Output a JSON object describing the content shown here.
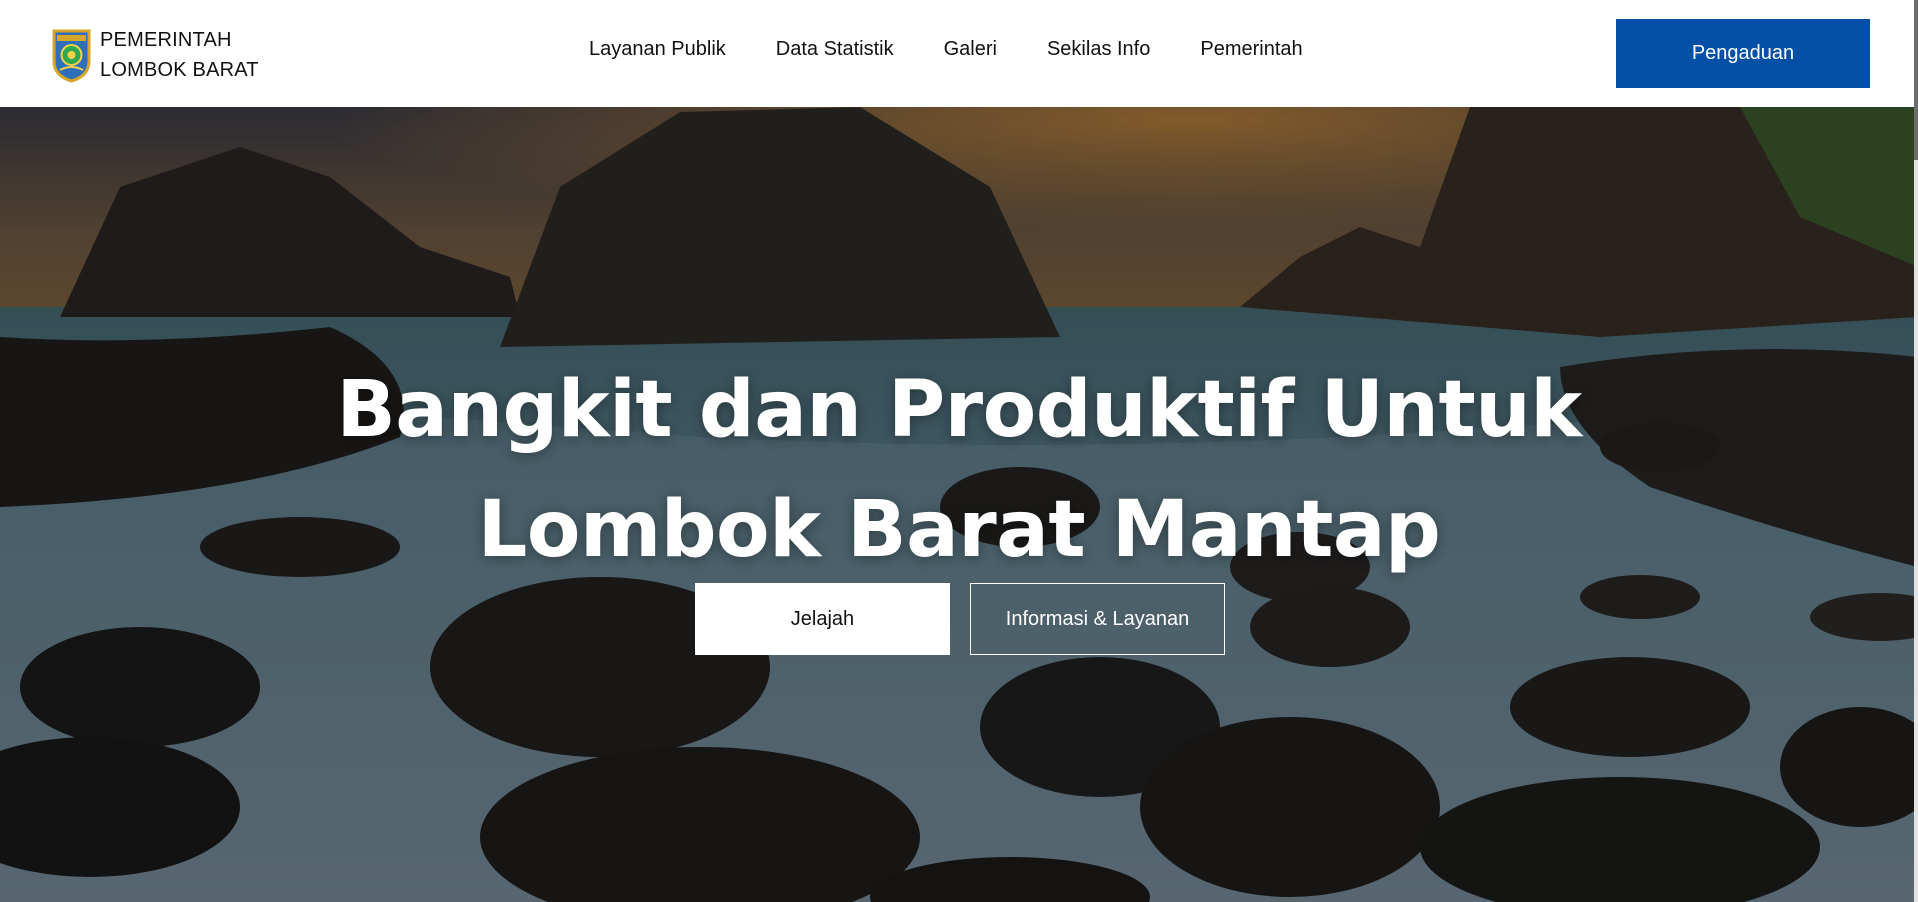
{
  "brand": {
    "line1": "PEMERINTAH",
    "line2": "LOMBOK BARAT",
    "logo_icon": "lombok-barat-emblem-icon"
  },
  "nav": {
    "items": [
      {
        "label": "Layanan Publik"
      },
      {
        "label": "Data Statistik"
      },
      {
        "label": "Galeri"
      },
      {
        "label": "Sekilas Info"
      },
      {
        "label": "Pemerintah"
      }
    ]
  },
  "cta": {
    "label": "Pengaduan",
    "color": "#0350a6"
  },
  "hero": {
    "title_line1": "Bangkit dan Produktif Untuk",
    "title_line2": "Lombok Barat Mantap",
    "background": "rocky-beach-sunset-photo",
    "primary_button": "Jelajah",
    "secondary_button": "Informasi & Layanan"
  }
}
